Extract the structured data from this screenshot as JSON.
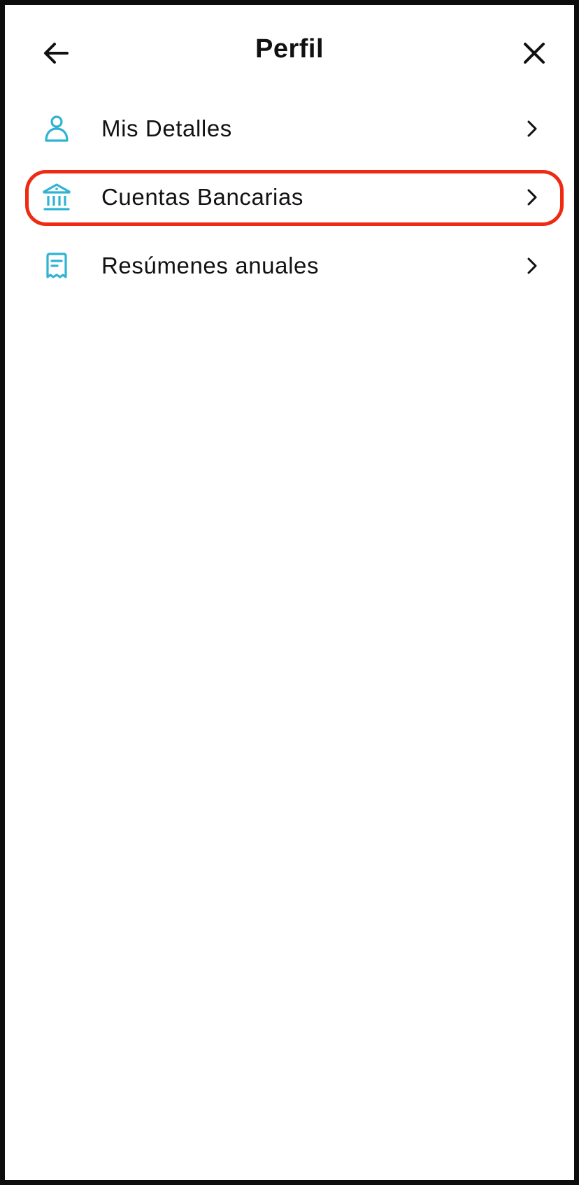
{
  "header": {
    "title": "Perfil",
    "back_icon": "arrow-left-icon",
    "close_icon": "close-icon"
  },
  "menu": {
    "items": [
      {
        "label": "Mis Detalles",
        "icon": "person-icon"
      },
      {
        "label": "Cuentas Bancarias",
        "icon": "bank-icon",
        "highlighted": true
      },
      {
        "label": "Resúmenes anuales",
        "icon": "receipt-icon"
      }
    ]
  },
  "colors": {
    "icon_accent": "#2fb3d3",
    "highlight": "#ee2a12",
    "text": "#121212",
    "frame": "#0d0d0d"
  }
}
